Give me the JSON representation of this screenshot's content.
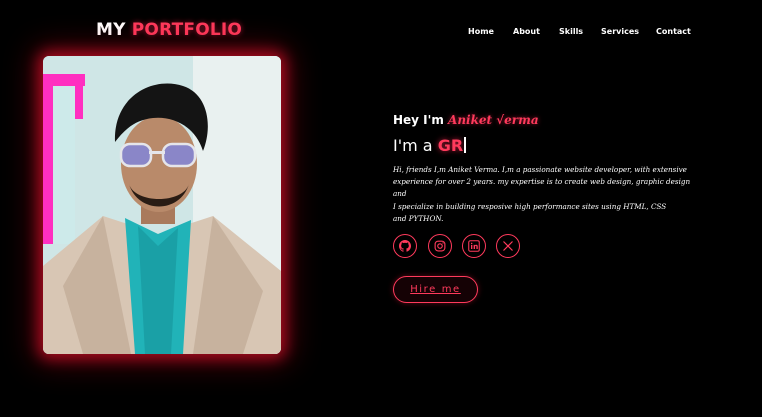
{
  "header": {
    "logo_part1": "MY",
    "logo_part2": "PORTFOLIO",
    "nav": [
      "Home",
      "About",
      "Skills",
      "Services",
      "Contact"
    ]
  },
  "hero": {
    "greeting": "Hey I'm",
    "name": "Aniket √erma",
    "role_prefix": "I'm a",
    "role_typed": "GR",
    "bio_lines": [
      "Hi, friends I,m Aniket Verma. I,m a passionate website developer, with extensive",
      "experience for over 2 years. my expertise is to create web design, graphic design and",
      "I specialize in building resposive high performance sites using HTML, CSS",
      "and PYTHON."
    ],
    "hire_label": "Hire me",
    "social_icons": [
      "github-icon",
      "instagram-icon",
      "linkedin-icon",
      "x-icon"
    ]
  },
  "theme": {
    "accent": "#ff3a5c",
    "background": "#000000"
  }
}
